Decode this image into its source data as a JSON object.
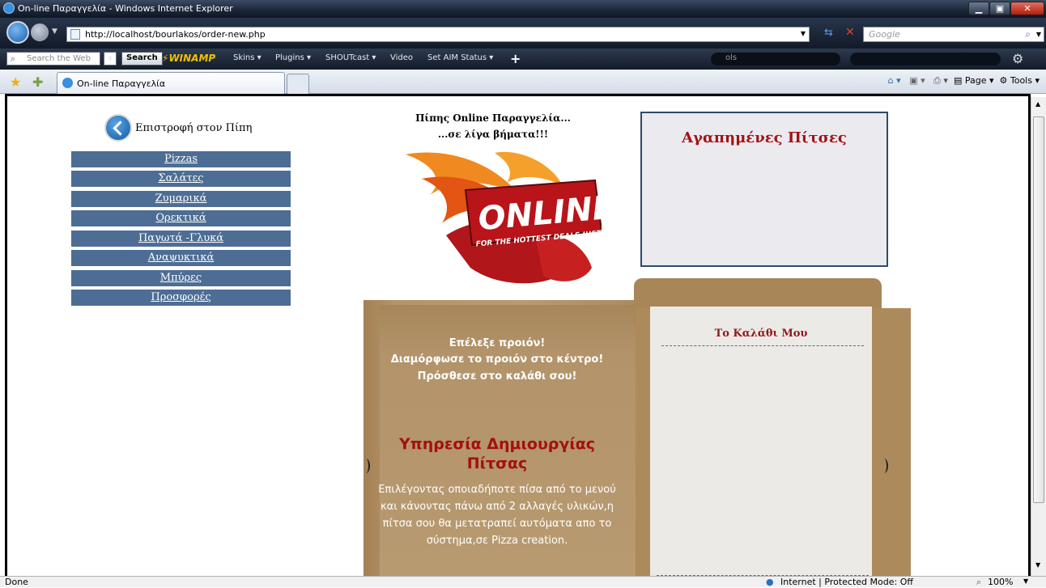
{
  "window": {
    "title": "On-line Παραγγελία - Windows Internet Explorer",
    "url": "http://localhost/bourlakos/order-new.php",
    "search_placeholder": "Google"
  },
  "toolbar": {
    "search_web_placeholder": "Search the Web",
    "search_button": "Search",
    "winamp": "WINAMP",
    "items": [
      "Skins ▾",
      "Plugins ▾",
      "SHOUTcast ▾",
      "Video",
      "Set AIM Status ▾"
    ],
    "field_text": "ols"
  },
  "tabs": {
    "active_label": "On-line Παραγγελία"
  },
  "command_bar": {
    "page": "Page",
    "tools": "Tools"
  },
  "page": {
    "back_link": "Επιστροφή στον Πίπη",
    "menu": [
      "Pizzas",
      "Σαλάτες",
      "Ζυμαρικά",
      "Ορεκτικά",
      "Παγωτά -Γλυκά",
      "Αναψυκτικά",
      "Μπύρες",
      "Προσφορές"
    ],
    "header_line1": "Πίπης Online Παραγγελία...",
    "header_line2": "...σε λίγα βήματα!!!",
    "logo_text": "ONLINE",
    "logo_sub": "FOR THE HOTTEST DEALS JUST CLICK...",
    "favorites_title": "Αγαπημένες Πίτσες",
    "instructions": [
      "Επέλεξε προιόν!",
      "Διαμόρφωσε το προιόν στο κέντρο!",
      "Πρόσθεσε στο καλάθι σου!"
    ],
    "service_title": "Υπηρεσία Δημιουργίας Πίτσας",
    "service_text": "Επιλέγοντας οποιαδήποτε πίσα από το μενού και κάνοντας πάνω από 2 αλλαγές υλικών,η πίτσα σου θα μετατραπεί αυτόματα απο το σύστημα,σε Pizza creation.",
    "cart_title": "Το Καλάθι Μου"
  },
  "status": {
    "left": "Done",
    "zone": "Internet | Protected Mode: Off",
    "zoom": "100%"
  }
}
